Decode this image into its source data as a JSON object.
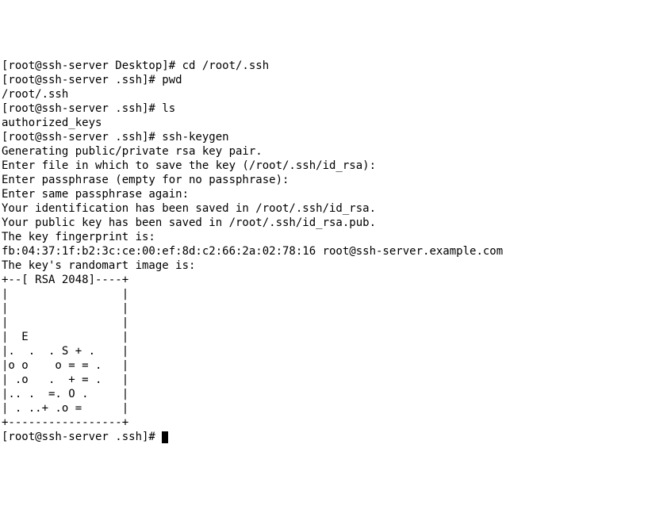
{
  "lines": [
    "[root@ssh-server Desktop]# cd /root/.ssh",
    "[root@ssh-server .ssh]# pwd",
    "/root/.ssh",
    "[root@ssh-server .ssh]# ls",
    "authorized_keys",
    "[root@ssh-server .ssh]# ssh-keygen",
    "Generating public/private rsa key pair.",
    "Enter file in which to save the key (/root/.ssh/id_rsa):",
    "Enter passphrase (empty for no passphrase):",
    "Enter same passphrase again:",
    "Your identification has been saved in /root/.ssh/id_rsa.",
    "Your public key has been saved in /root/.ssh/id_rsa.pub.",
    "The key fingerprint is:",
    "fb:04:37:1f:b2:3c:ce:00:ef:8d:c2:66:2a:02:78:16 root@ssh-server.example.com",
    "The key's randomart image is:",
    "+--[ RSA 2048]----+",
    "|                 |",
    "|                 |",
    "|                 |",
    "|  E              |",
    "|.  .  . S + .    |",
    "|o o    o = = .   |",
    "| .o   .  + = .   |",
    "|.. .  =. O .     |",
    "| . ..+ .o =      |",
    "+-----------------+",
    "[root@ssh-server .ssh]# "
  ],
  "last_line_index": 26
}
